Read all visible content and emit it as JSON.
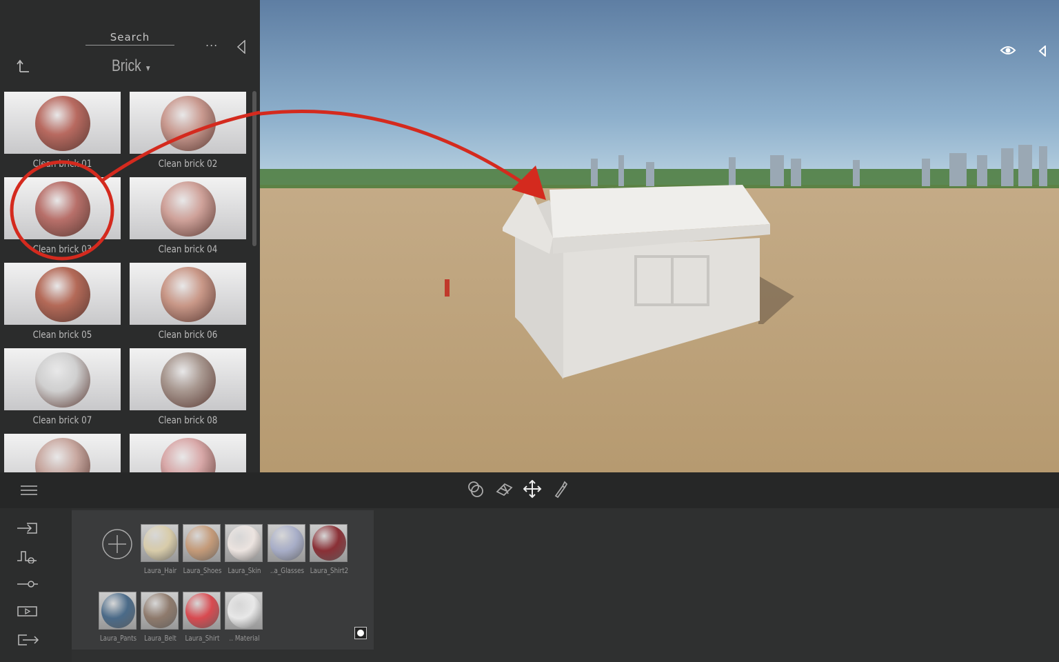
{
  "library": {
    "search_label": "Search",
    "more_label": "...",
    "category": "Brick",
    "items": [
      {
        "label": "Clean brick 01",
        "color": "#b86a60"
      },
      {
        "label": "Clean brick 02",
        "color": "#c99a90"
      },
      {
        "label": "Clean brick 03",
        "color": "#b8706a"
      },
      {
        "label": "Clean brick 04",
        "color": "#cfa29a"
      },
      {
        "label": "Clean brick 05",
        "color": "#b46a58"
      },
      {
        "label": "Clean brick 06",
        "color": "#c99888"
      },
      {
        "label": "Clean brick 07",
        "color": "#d0d0d0"
      },
      {
        "label": "Clean brick 08",
        "color": "#a89890"
      },
      {
        "label": "",
        "color": "#c8a8a0"
      },
      {
        "label": "",
        "color": "#d8a8a8"
      }
    ]
  },
  "toolbar": {
    "tools": [
      "select-objects-icon",
      "material-tool-icon",
      "move-icon",
      "eyedropper-icon"
    ]
  },
  "side_tools": [
    "import-icon",
    "animation-icon",
    "path-icon",
    "video-icon",
    "export-icon"
  ],
  "materials": {
    "add_label": "+",
    "items": [
      {
        "label": "Laura_Hair",
        "color": "#d8ccaa"
      },
      {
        "label": "Laura_Shoes",
        "color": "#c49a78"
      },
      {
        "label": "Laura_Skin",
        "color": "#ece4e0"
      },
      {
        "label": "..a_Glasses",
        "color": "#a8aec8"
      },
      {
        "label": "Laura_Shirt2",
        "color": "#8a3036"
      },
      {
        "label": "Laura_Pants",
        "color": "#4a6a88"
      },
      {
        "label": "Laura_Belt",
        "color": "#8e7a6c"
      },
      {
        "label": "Laura_Shirt",
        "color": "#d84a50"
      },
      {
        "label": ".. Material",
        "color": "#e8e8e8"
      }
    ]
  },
  "annotation_color": "#d42a1e"
}
